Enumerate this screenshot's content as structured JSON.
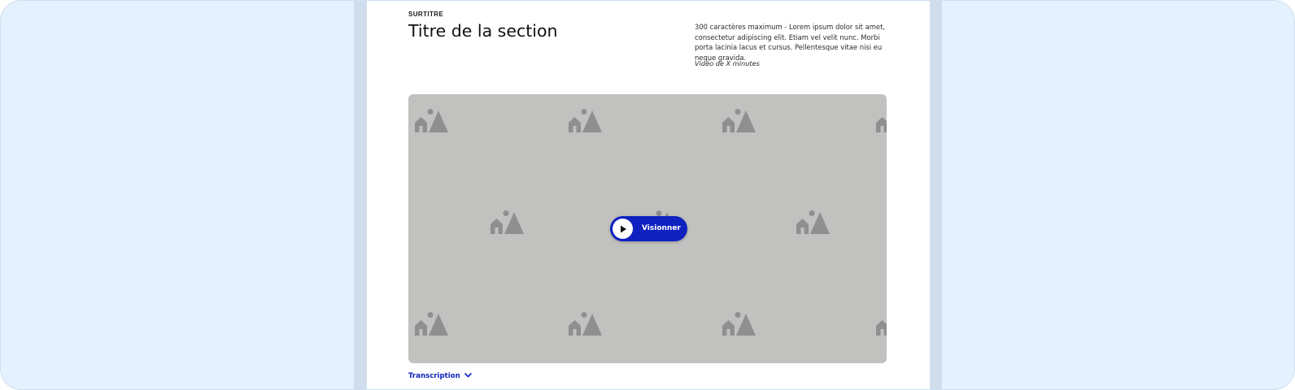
{
  "section": {
    "eyebrow": "SURTITRE",
    "title": "Titre de la section",
    "description": "300 caractères maximum - Lorem ipsum dolor sit amet, consectetur adipiscing elit. Etiam vel velit nunc. Morbi porta lacinia lacus et cursus. Pellentesque vitae nisi eu neque gravida.",
    "duration": "Vidéo de X minutes"
  },
  "video": {
    "play_label": "Visionner",
    "play_icon": "play-icon",
    "placeholder_icon": "image-placeholder-icon"
  },
  "transcription": {
    "label": "Transcription",
    "icon": "chevron-down-icon"
  },
  "colors": {
    "accent": "#0f22c0",
    "canvas": "#e4f1fe",
    "column": "#d0dded",
    "video_placeholder": "#c1c1bf"
  }
}
